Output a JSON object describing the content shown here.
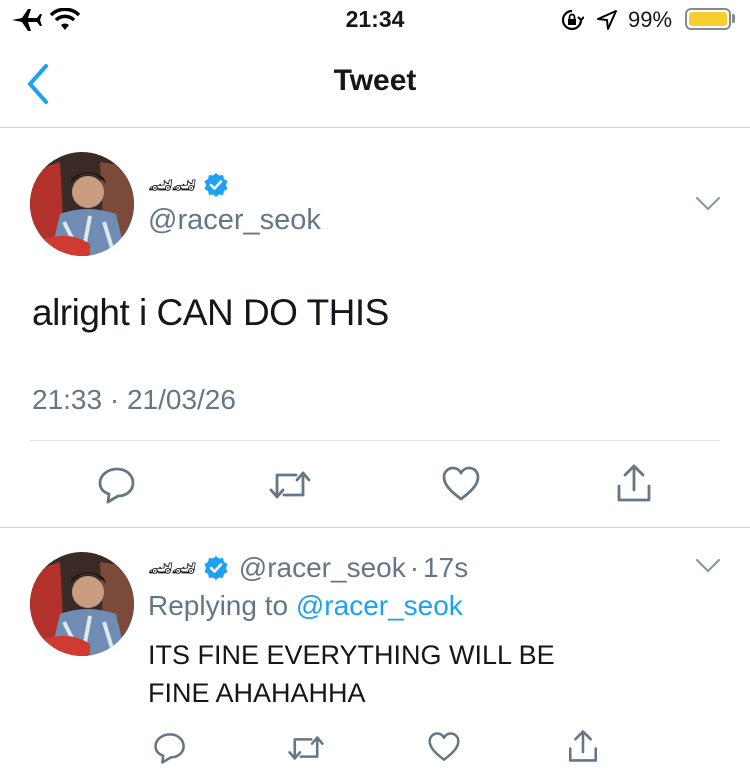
{
  "status_bar": {
    "time": "21:34",
    "battery_percent": "99%",
    "battery_level": 0.99,
    "battery_color": "#f7ce2f",
    "icons": [
      "airplane-icon",
      "wifi-icon",
      "rotation-lock-icon",
      "location-icon",
      "battery-icon"
    ]
  },
  "nav": {
    "title": "Tweet",
    "back_icon": "chevron-left-icon",
    "accent": "#1da1f2"
  },
  "main_tweet": {
    "display_name_emoji": "🏎🏎",
    "verified": true,
    "handle": "@racer_seok",
    "text": "alright i CAN DO THIS",
    "timestamp": "21:33 · 21/03/26",
    "actions": [
      "reply-icon",
      "retweet-icon",
      "like-icon",
      "share-icon"
    ]
  },
  "reply_tweet": {
    "display_name_emoji": "🏎🏎",
    "verified": true,
    "handle": "@racer_seok",
    "separator": "·",
    "age": "17s",
    "replying_label": "Replying to",
    "replying_handle": "@racer_seok",
    "text_line1": "ITS FINE EVERYTHING WILL BE",
    "text_line2": "FINE AHAHAHHA",
    "actions": [
      "reply-icon",
      "retweet-icon",
      "like-icon",
      "share-icon"
    ]
  }
}
